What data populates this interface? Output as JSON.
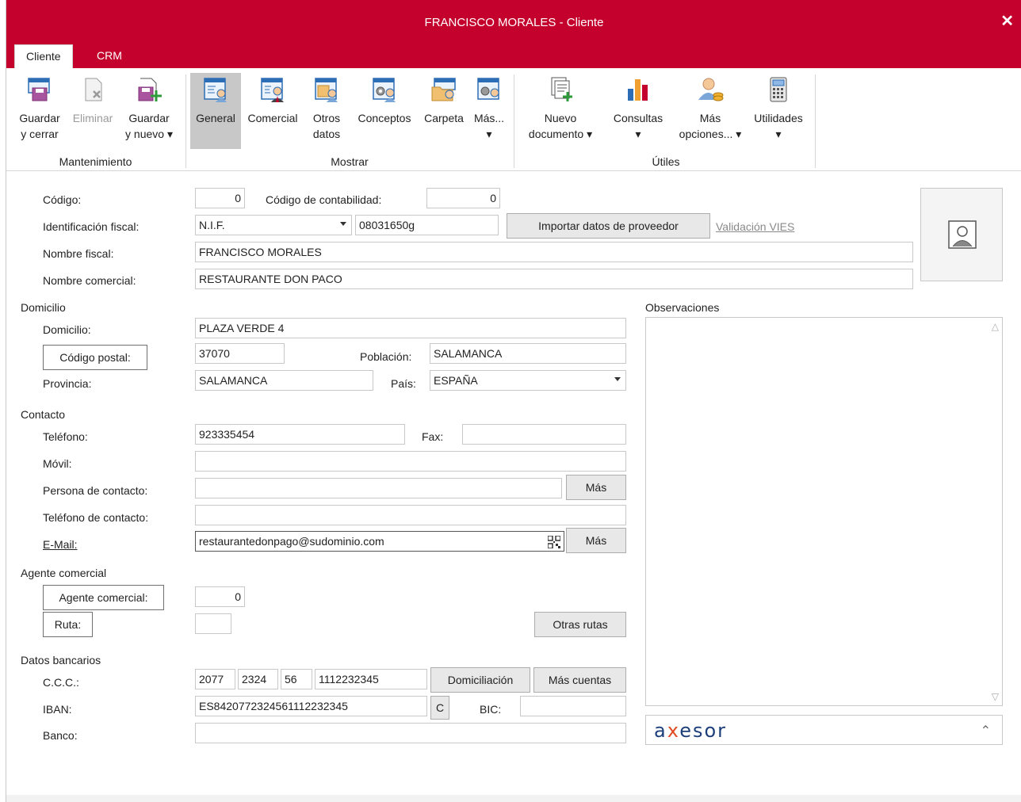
{
  "window": {
    "title": "FRANCISCO MORALES - Cliente",
    "close": "✕"
  },
  "tabs": [
    {
      "label": "Cliente"
    },
    {
      "label": "CRM"
    }
  ],
  "ribbon": {
    "groups": {
      "mantenimiento": "Mantenimiento",
      "mostrar": "Mostrar",
      "utiles": "Útiles"
    },
    "buttons": {
      "guardar_cerrar": [
        "Guardar",
        "y cerrar"
      ],
      "eliminar": "Eliminar",
      "guardar_nuevo": [
        "Guardar",
        "y nuevo ▾"
      ],
      "general": "General",
      "comercial": "Comercial",
      "otros_datos": [
        "Otros",
        "datos"
      ],
      "conceptos": "Conceptos",
      "carpeta": "Carpeta",
      "mas": [
        "Más...",
        "▾"
      ],
      "nuevo_documento": [
        "Nuevo",
        "documento ▾"
      ],
      "consultas": [
        "Consultas",
        "▾"
      ],
      "mas_opciones": [
        "Más",
        "opciones... ▾"
      ],
      "utilidades": [
        "Utilidades",
        "▾"
      ]
    }
  },
  "form": {
    "codigo_label": "Código:",
    "codigo": "0",
    "codigo_contab_label": "Código de contabilidad:",
    "codigo_contab": "0",
    "idfiscal_label": "Identificación fiscal:",
    "idfiscal_type": "N.I.F.",
    "idfiscal_value": "08031650g",
    "importar_btn": "Importar datos de proveedor",
    "vies_link": "Validación VIES",
    "nombre_fiscal_label": "Nombre fiscal:",
    "nombre_fiscal": "FRANCISCO MORALES",
    "nombre_comercial_label": "Nombre comercial:",
    "nombre_comercial": "RESTAURANTE DON PACO",
    "domicilio_section": "Domicilio",
    "domicilio_label": "Domicilio:",
    "domicilio": "PLAZA VERDE 4",
    "cp_btn": "Código postal:",
    "cp": "37070",
    "poblacion_label": "Población:",
    "poblacion": "SALAMANCA",
    "provincia_label": "Provincia:",
    "provincia": "SALAMANCA",
    "pais_label": "País:",
    "pais": "ESPAÑA",
    "contacto_section": "Contacto",
    "telefono_label": "Teléfono:",
    "telefono": "923335454",
    "fax_label": "Fax:",
    "fax": "",
    "movil_label": "Móvil:",
    "movil": "",
    "persona_label": "Persona de contacto:",
    "persona": "",
    "mas_btn": "Más",
    "telcontacto_label": "Teléfono de contacto:",
    "telcontacto": "",
    "email_label": "E-Mail:",
    "email": "restaurantedonpago@sudominio.com",
    "agente_section": "Agente comercial",
    "agente_btn": "Agente comercial:",
    "agente": "0",
    "ruta_btn": "Ruta:",
    "ruta": "",
    "otras_rutas_btn": "Otras rutas",
    "banco_section": "Datos bancarios",
    "ccc_label": "C.C.C.:",
    "ccc": [
      "2077",
      "2324",
      "56",
      "1112232345"
    ],
    "domiciliacion_btn": "Domiciliación",
    "mas_cuentas_btn": "Más cuentas",
    "iban_label": "IBAN:",
    "iban": "ES8420772324561112232345",
    "iban_c_btn": "C",
    "bic_label": "BIC:",
    "bic": "",
    "banco_label": "Banco:",
    "banco": "",
    "observaciones_label": "Observaciones",
    "observaciones": "",
    "axesor_logo": "axesor"
  },
  "colors": {
    "titlebar": "#c4002c",
    "axesor_blue": "#1c3f7a",
    "axesor_orange": "#e14b23"
  }
}
